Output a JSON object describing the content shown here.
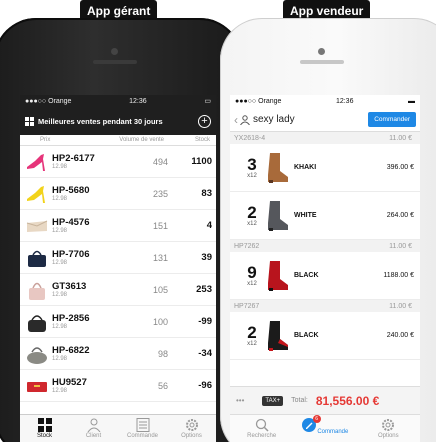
{
  "labels": {
    "left": "App gérant",
    "right": "App vendeur"
  },
  "manager": {
    "status": {
      "carrier": "Orange",
      "time": "12:36"
    },
    "title": "Meilleures ventes pendant 30 jours",
    "columns": {
      "price": "Prix",
      "volume": "Volume de vente",
      "stock": "Stock"
    },
    "rows": [
      {
        "code": "HP2-6177",
        "price": "12.98",
        "volume": "494",
        "stock": "1100",
        "item": "pink-heel-icon"
      },
      {
        "code": "HP-5680",
        "price": "12.98",
        "volume": "235",
        "stock": "83",
        "item": "yellow-heel-icon"
      },
      {
        "code": "HP-4576",
        "price": "12.98",
        "volume": "151",
        "stock": "4",
        "item": "beige-clutch-icon"
      },
      {
        "code": "HP-7706",
        "price": "12.98",
        "volume": "131",
        "stock": "39",
        "item": "navy-bag-icon"
      },
      {
        "code": "GT3613",
        "price": "12.98",
        "volume": "105",
        "stock": "253",
        "item": "pink-bag-icon"
      },
      {
        "code": "HP-2856",
        "price": "12.98",
        "volume": "100",
        "stock": "-99",
        "item": "black-bag-icon"
      },
      {
        "code": "HP-6822",
        "price": "12.98",
        "volume": "98",
        "stock": "-34",
        "item": "grey-bag-icon"
      },
      {
        "code": "HU9527",
        "price": "12.98",
        "volume": "56",
        "stock": "-96",
        "item": "red-clutch-icon"
      }
    ],
    "tabs": [
      "Stock",
      "Client",
      "Commande",
      "Options"
    ]
  },
  "seller": {
    "status": {
      "carrier": "Orange",
      "time": "12:36"
    },
    "customer": "sexy lady",
    "order_button": "Commander",
    "groups": [
      {
        "ref": "YX2618-4",
        "subtotal": "11.00 €",
        "lines": [
          {
            "qty": "3",
            "mult": "x12",
            "color": "KHAKI",
            "amount": "396.00 €",
            "item": "khaki-boot-icon"
          },
          {
            "qty": "2",
            "mult": "x12",
            "color": "WHITE",
            "amount": "264.00 €",
            "item": "grey-boot-icon"
          }
        ]
      },
      {
        "ref": "HP7262",
        "subtotal": "11.00 €",
        "lines": [
          {
            "qty": "9",
            "mult": "x12",
            "color": "BLACK",
            "amount": "1188.00 €",
            "item": "red-boot-icon"
          }
        ]
      },
      {
        "ref": "HP7267",
        "subtotal": "11.00 €",
        "lines": [
          {
            "qty": "2",
            "mult": "x12",
            "color": "BLACK",
            "amount": "240.00 €",
            "item": "black-red-boot-icon"
          }
        ]
      }
    ],
    "tax_label": "TAX+",
    "total_label": "Total:",
    "total_value": "81,556.00 €",
    "tabs": [
      "Recherche",
      "Commande",
      "Options"
    ],
    "badge": "6"
  },
  "colors": {
    "accent": "#1e88e5",
    "total": "#e53935",
    "dark": "#1f1f1f"
  }
}
